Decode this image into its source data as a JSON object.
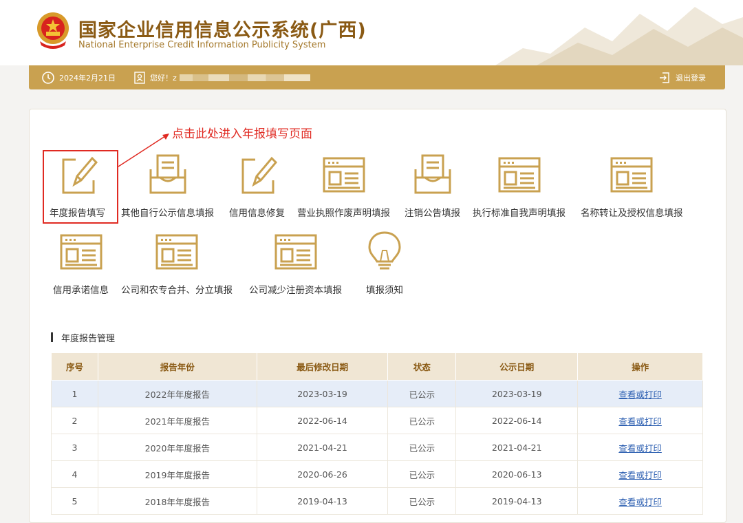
{
  "header": {
    "title": "国家企业信用信息公示系统(广西)",
    "subtitle": "National Enterprise Credit Information Publicity System"
  },
  "topbar": {
    "date": "2024年2月21日",
    "greeting": "您好！z",
    "logout": "退出登录"
  },
  "annotation": "点击此处进入年报填写页面",
  "tiles": [
    {
      "label": "年度报告填写",
      "icon": "pencil-edit-icon"
    },
    {
      "label": "其他自行公示信息填报",
      "icon": "document-tray-icon"
    },
    {
      "label": "信用信息修复",
      "icon": "pencil-edit-icon"
    },
    {
      "label": "营业执照作废声明填报",
      "icon": "form-window-icon"
    },
    {
      "label": "注销公告填报",
      "icon": "document-tray-icon"
    },
    {
      "label": "执行标准自我声明填报",
      "icon": "form-window-icon"
    },
    {
      "label": "名称转让及授权信息填报",
      "icon": "form-window-icon"
    },
    {
      "label": "信用承诺信息",
      "icon": "form-window-icon"
    },
    {
      "label": "公司和农专合并、分立填报",
      "icon": "form-window-icon"
    },
    {
      "label": "公司减少注册资本填报",
      "icon": "form-window-icon"
    },
    {
      "label": "填报须知",
      "icon": "lightbulb-icon"
    }
  ],
  "section_title": "年度报告管理",
  "table": {
    "headers": [
      "序号",
      "报告年份",
      "最后修改日期",
      "状态",
      "公示日期",
      "操作"
    ],
    "rows": [
      [
        "1",
        "2022年年度报告",
        "2023-03-19",
        "已公示",
        "2023-03-19",
        "查看或打印"
      ],
      [
        "2",
        "2021年年度报告",
        "2022-06-14",
        "已公示",
        "2022-06-14",
        "查看或打印"
      ],
      [
        "3",
        "2020年年度报告",
        "2021-04-21",
        "已公示",
        "2021-04-21",
        "查看或打印"
      ],
      [
        "4",
        "2019年年度报告",
        "2020-06-26",
        "已公示",
        "2020-06-13",
        "查看或打印"
      ],
      [
        "5",
        "2018年年度报告",
        "2019-04-13",
        "已公示",
        "2019-04-13",
        "查看或打印"
      ]
    ]
  },
  "colors": {
    "gold": "#c9a150",
    "brown": "#8a5a14",
    "red": "#e02a22",
    "link": "#2a5db0"
  }
}
